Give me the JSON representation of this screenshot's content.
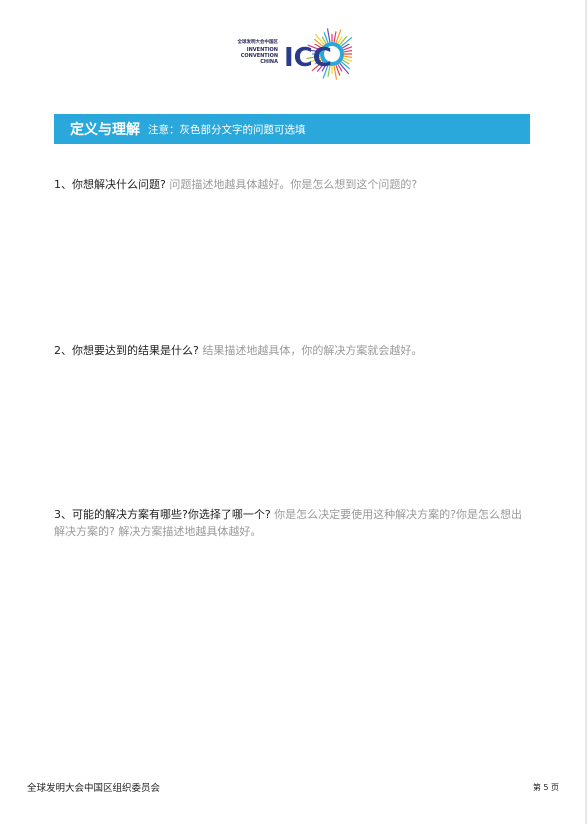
{
  "logo": {
    "cn_text": "全球发明大会中国区",
    "en_lines": [
      "INVENTION",
      "CONVENTION",
      "CHINA"
    ],
    "letters": "ICC",
    "brand_color": "#2a3a8c",
    "accent_color": "#2aa8dc"
  },
  "section": {
    "title": "定义与理解",
    "note": "注意：灰色部分文字的问题可选填",
    "bar_color": "#2aa8dc"
  },
  "questions": [
    {
      "main": "1、你想解决什么问题?",
      "hint": " 问题描述地越具体越好。你是怎么想到这个问题的?"
    },
    {
      "main": "2、你想要达到的结果是什么?",
      "hint": " 结果描述地越具体，你的解决方案就会越好。"
    },
    {
      "main": "3、可能的解决方案有哪些?你选择了哪一个?",
      "hint": " 你是怎么决定要使用这种解决方案的?你是怎么想出解决方案的? 解决方案描述地越具体越好。"
    }
  ],
  "footer": {
    "org": "全球发明大会中国区组织委员会",
    "page": "第 5 页"
  }
}
